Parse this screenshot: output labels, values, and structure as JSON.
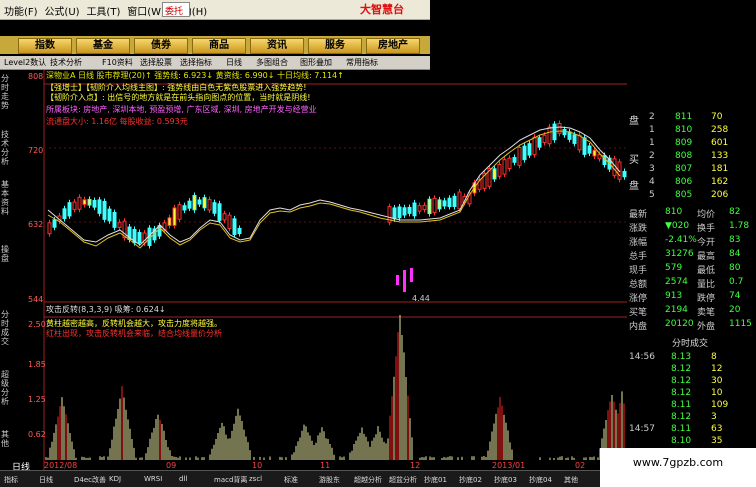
{
  "menu": {
    "items": [
      "功能(F)",
      "公式(U)",
      "工具(T)",
      "窗口(W)",
      "帮助(H)"
    ],
    "stock_code": "委托",
    "brand": "大智慧台"
  },
  "categories": [
    "指数",
    "基金",
    "债券",
    "商品",
    "资讯",
    "服务",
    "房地产"
  ],
  "toolbar": {
    "items": [
      "Level2数认",
      "技术分析",
      "F10资料",
      "选择股票",
      "选择指标",
      "日线",
      "多图组合",
      "图形叠加",
      "常用指标"
    ]
  },
  "chart": {
    "title_line": "深物业A  日线  股市荐理(20)↑ 强势线: 6.923↓ 黄资线: 6.990↓ 十日均线: 7.114↑",
    "annot1": "【强增士】【韧阶介入均线主图】: 强势线由白色无紫色股票进入强势趋势!",
    "annot2": "【韧阶介入点】: 出信号的地方就是在前头指向图点的位置，当时就是阴线!",
    "annot3": "所属板块: 房地产, 深圳本地, 预盈预增, 广东区域, 深圳, 房地产开发与经营业",
    "annot4": "流通盘大小: 1.16亿  每股收益: 0.593元",
    "left_labels": [
      "808",
      "720",
      "632",
      "544"
    ],
    "ind_title": "攻击反转(8,3,3,9)  吸筹: 0.624↓",
    "ind_text1": "黄柱越密越高，反转机会越大，攻击力度将越强。",
    "ind_text2": "红柱出现，攻击反转机会来临，结合均线量价分析",
    "ind_labels": [
      "2.50",
      "1.85",
      "1.25",
      "0.62"
    ],
    "x_labels": [
      "2012/08",
      "09",
      "10",
      "11",
      "12",
      "2013/01",
      "02"
    ],
    "low_label": "4.44",
    "vtabs": [
      "分时走势",
      "技术分析",
      "基本资料",
      "操盘",
      "分时成交",
      "超级分析",
      "其他"
    ],
    "day_label": "日线"
  },
  "quote": {
    "book": [
      {
        "side": "盘",
        "lvl": "2",
        "p": "811",
        "v": "70"
      },
      {
        "side": "",
        "lvl": "1",
        "p": "810",
        "v": "258"
      },
      {
        "side": "",
        "lvl": "1",
        "p": "809",
        "v": "601"
      },
      {
        "side": "买",
        "lvl": "2",
        "p": "808",
        "v": "133"
      },
      {
        "side": "",
        "lvl": "3",
        "p": "807",
        "v": "181"
      },
      {
        "side": "盘",
        "lvl": "4",
        "p": "806",
        "v": "162"
      },
      {
        "side": "",
        "lvl": "5",
        "p": "805",
        "v": "206"
      }
    ],
    "stats": [
      {
        "k": "最新",
        "v": "810",
        "k2": "均价",
        "v2": "82"
      },
      {
        "k": "涨跌",
        "v": "▼020",
        "k2": "换手",
        "v2": "1.78"
      },
      {
        "k": "涨幅",
        "v": "-2.41%",
        "k2": "今开",
        "v2": "83"
      },
      {
        "k": "总手",
        "v": "31276",
        "k2": "最高",
        "v2": "84"
      },
      {
        "k": "现手",
        "v": "579",
        "k2": "最低",
        "v2": "80"
      },
      {
        "k": "总额",
        "v": "2574",
        "k2": "量比",
        "v2": "0.7"
      },
      {
        "k": "涨停",
        "v": "913",
        "k2": "跌停",
        "v2": "74"
      },
      {
        "k": "买笔",
        "v": "2194",
        "k2": "卖笔",
        "v2": "20"
      },
      {
        "k": "内盘",
        "v": "20120",
        "k2": "外盘",
        "v2": "1115"
      }
    ],
    "ticks_title": "分时成交",
    "ticks": [
      {
        "t": "14:56",
        "p": "8.13",
        "v": "8"
      },
      {
        "t": "",
        "p": "8.12",
        "v": "12"
      },
      {
        "t": "",
        "p": "8.12",
        "v": "30"
      },
      {
        "t": "",
        "p": "8.12",
        "v": "10"
      },
      {
        "t": "",
        "p": "8.11",
        "v": "109"
      },
      {
        "t": "",
        "p": "8.12",
        "v": "3"
      },
      {
        "t": "14:57",
        "p": "8.11",
        "v": "63"
      },
      {
        "t": "",
        "p": "8.10",
        "v": "35"
      }
    ]
  },
  "bottom": {
    "items": [
      "指标",
      "日线",
      "D4ec改善",
      "KDJ",
      "WRSI",
      "dll",
      "macd背离",
      "zscl",
      "标准",
      "游股东",
      "超越分析",
      "超盆分析",
      "抄底01",
      "抄底02",
      "抄底03",
      "抄底04",
      "其他"
    ]
  },
  "watermark": "www.7gpzb.com"
}
